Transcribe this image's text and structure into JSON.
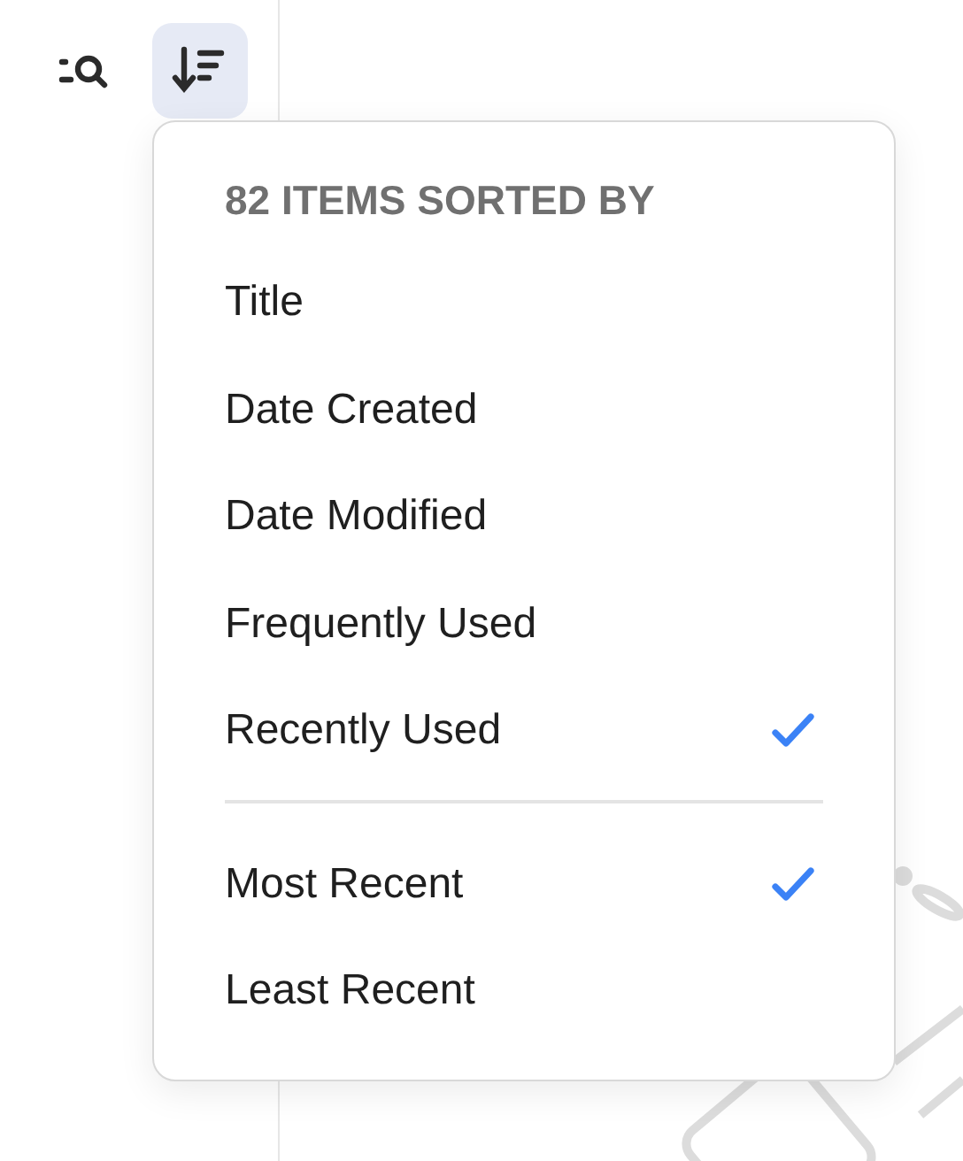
{
  "toolbar": {
    "sort_button": {
      "selected": true
    }
  },
  "sort_menu": {
    "header": "82 ITEMS SORTED BY",
    "sort_fields": [
      {
        "label": "Title",
        "selected": false
      },
      {
        "label": "Date Created",
        "selected": false
      },
      {
        "label": "Date Modified",
        "selected": false
      },
      {
        "label": "Frequently Used",
        "selected": false
      },
      {
        "label": "Recently Used",
        "selected": true
      }
    ],
    "sort_order": [
      {
        "label": "Most Recent",
        "selected": true
      },
      {
        "label": "Least Recent",
        "selected": false
      }
    ]
  }
}
